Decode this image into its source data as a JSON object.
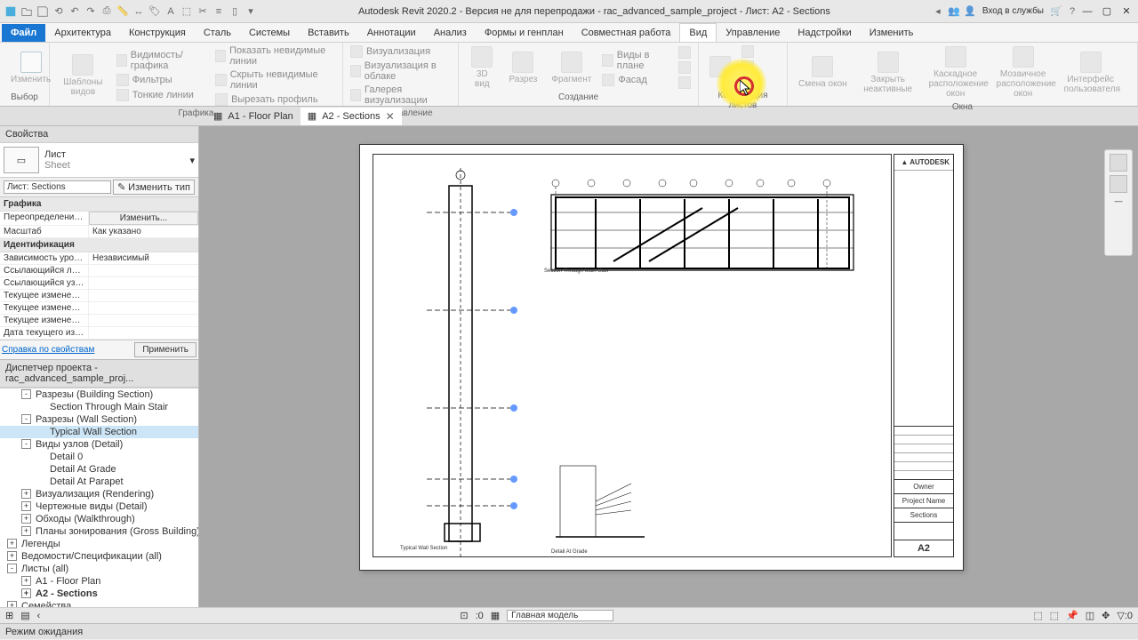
{
  "title": "Autodesk Revit 2020.2 - Версия не для перепродажи - rac_advanced_sample_project - Лист: A2 - Sections",
  "signin": "Вход в службы",
  "ribbonTabs": {
    "file": "Файл",
    "items": [
      "Архитектура",
      "Конструкция",
      "Сталь",
      "Системы",
      "Вставить",
      "Аннотации",
      "Анализ",
      "Формы и генплан",
      "Совместная работа",
      "Вид",
      "Управление",
      "Надстройки",
      "Изменить"
    ],
    "activeIndex": 9
  },
  "ribbonPanels": {
    "selection": {
      "title": "Выбор",
      "modify": "Изменить"
    },
    "graphics": {
      "title": "Графика",
      "templates": "Шаблоны\nвидов",
      "items": [
        "Видимость/ графика",
        "Фильтры",
        "Тонкие линии",
        "Показать невидимые линии",
        "Скрыть невидимые линии",
        "Вырезать профиль"
      ]
    },
    "presentation": {
      "title": "Представление",
      "items": [
        "Визуализация",
        "Визуализация в облаке",
        "Галерея визуализации"
      ]
    },
    "create": {
      "title": "Создание",
      "threeD": "3D\nвид",
      "section": "Разрез",
      "fragment": "Фрагмент",
      "items": [
        "Виды в плане",
        "Фасад"
      ]
    },
    "sheets": {
      "title": "Композиция листов"
    },
    "windows": {
      "title": "Окна",
      "switch": "Смена\nокон",
      "close": "Закрыть\nнеактивные",
      "cascade": "Каскадное\nрасположение окон",
      "tile": "Мозаичное\nрасположение окон",
      "ui": "Интерфейс\nпользователя"
    }
  },
  "docTabs": [
    {
      "label": "A1 - Floor Plan",
      "active": false
    },
    {
      "label": "A2 - Sections",
      "active": true
    }
  ],
  "props": {
    "palette": "Свойства",
    "typeName": "Лист",
    "typeEn": "Sheet",
    "instance": "Лист: Sections",
    "editType": "Изменить тип",
    "catGraphics": "Графика",
    "overrides_k": "Переопределения ...",
    "overrides_v": "Изменить...",
    "scale_k": "Масштаб",
    "scale_v": "Как указано",
    "catIdent": "Идентификация",
    "dep_k": "Зависимость уровня",
    "dep_v": "Независимый",
    "rows": [
      "Ссылающийся лист",
      "Ссылающийся узел",
      "Текущее изменени...",
      "Текущее изменени...",
      "Текущее изменени...",
      "Дата текущего изм..."
    ],
    "helpLink": "Справка по свойствам",
    "apply": "Применить"
  },
  "browser": {
    "title": "Диспетчер проекта - rac_advanced_sample_proj...",
    "items": [
      {
        "l": 2,
        "t": "Разрезы (Building Section)",
        "exp": "-"
      },
      {
        "l": 3,
        "t": "Section Through Main Stair"
      },
      {
        "l": 2,
        "t": "Разрезы (Wall Section)",
        "exp": "-"
      },
      {
        "l": 3,
        "t": "Typical Wall Section",
        "sel": true
      },
      {
        "l": 2,
        "t": "Виды узлов (Detail)",
        "exp": "-"
      },
      {
        "l": 3,
        "t": "Detail 0"
      },
      {
        "l": 3,
        "t": "Detail At Grade"
      },
      {
        "l": 3,
        "t": "Detail At Parapet"
      },
      {
        "l": 2,
        "t": "Визуализация (Rendering)",
        "exp": "+"
      },
      {
        "l": 2,
        "t": "Чертежные виды (Detail)",
        "exp": "+"
      },
      {
        "l": 2,
        "t": "Обходы (Walkthrough)",
        "exp": "+"
      },
      {
        "l": 2,
        "t": "Планы зонирования (Gross Building)",
        "exp": "+"
      },
      {
        "l": 1,
        "t": "Легенды",
        "exp": "+"
      },
      {
        "l": 1,
        "t": "Ведомости/Спецификации (all)",
        "exp": "+"
      },
      {
        "l": 1,
        "t": "Листы (all)",
        "exp": "-"
      },
      {
        "l": 2,
        "t": "A1 - Floor Plan",
        "exp": "+"
      },
      {
        "l": 2,
        "t": "A2 - Sections",
        "exp": "+",
        "bold": true
      },
      {
        "l": 1,
        "t": "Семейства",
        "exp": "+"
      }
    ]
  },
  "titleBlock": {
    "logo": "▲ AUTODESK",
    "owner": "Owner",
    "project": "Project Name",
    "sheet": "Sections",
    "num": "A2"
  },
  "captions": {
    "sv1": "Section Through Main Stair",
    "sv3": "Detail At Grade",
    "sv4": "Typical Wall Section"
  },
  "status": "Режим ожидания",
  "viewctrl": {
    "zoom": ":0",
    "model": "Главная модель"
  }
}
